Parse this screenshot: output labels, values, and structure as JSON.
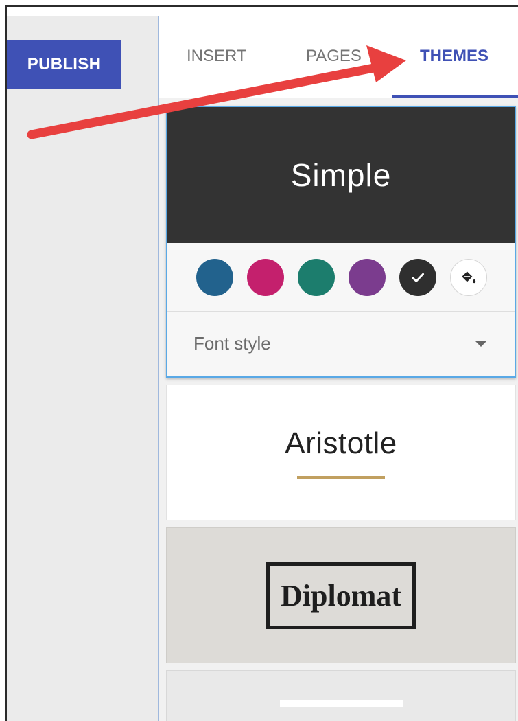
{
  "toolbar": {
    "publish_label": "PUBLISH"
  },
  "tabs": [
    {
      "label": "INSERT",
      "active": false
    },
    {
      "label": "PAGES",
      "active": false
    },
    {
      "label": "THEMES",
      "active": true
    }
  ],
  "themes": {
    "simple": {
      "name": "Simple",
      "swatches": [
        {
          "name": "blue",
          "color": "#22628d",
          "selected": false
        },
        {
          "name": "magenta",
          "color": "#c4206d",
          "selected": false
        },
        {
          "name": "teal",
          "color": "#1c7d6d",
          "selected": false
        },
        {
          "name": "purple",
          "color": "#7b3c8e",
          "selected": false
        },
        {
          "name": "dark-gray",
          "color": "#2f2f2f",
          "selected": true
        }
      ],
      "custom_color_icon": "paint-bucket-icon",
      "font_style_label": "Font style"
    },
    "aristotle": {
      "name": "Aristotle",
      "accent": "#c1a060"
    },
    "diplomat": {
      "name": "Diplomat"
    }
  },
  "colors": {
    "accent": "#3f51b5",
    "annotation_arrow": "#e8403f"
  }
}
